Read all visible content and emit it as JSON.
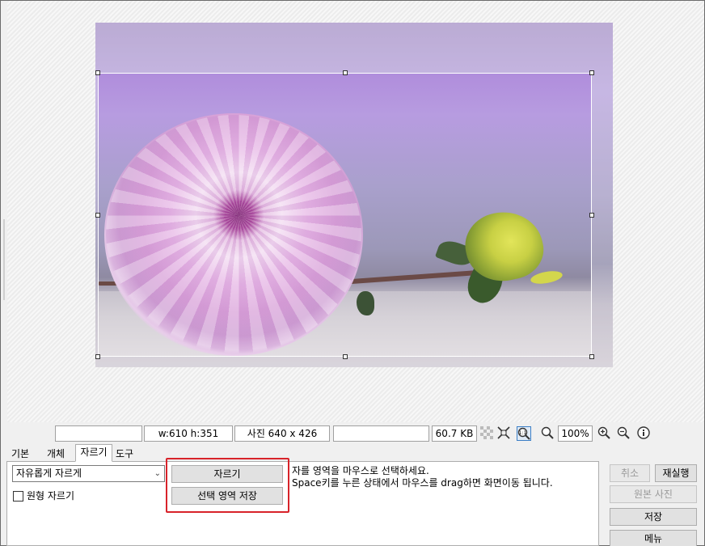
{
  "status": {
    "box1": "",
    "dimensions": "w:610 h:351",
    "photo_size": "사진 640 x 426",
    "box4": "",
    "file_size": "60.7 KB",
    "zoom": "100%",
    "icons": [
      "transparency-icon",
      "fit-window-icon",
      "actual-size-icon",
      "zoom-icon",
      "zoom-in-icon",
      "zoom-out-icon",
      "info-icon"
    ]
  },
  "tabs": [
    "기본",
    "개체",
    "자르기",
    "도구"
  ],
  "active_tab": "자르기",
  "crop": {
    "mode_select": "자유롭게 자르게",
    "circle_crop_label": "원형 자르기",
    "crop_button": "자르기",
    "save_selection_button": "선택 영역 저장",
    "info_line1": "자를 영역을 마우스로 선택하세요.",
    "info_line2": "Space키를 누른 상태에서 마우스를 drag하면 화면이동 됩니다."
  },
  "actions": {
    "cancel": "취소",
    "redo": "재실행",
    "original": "원본 사진",
    "save": "저장",
    "menu": "메뉴"
  },
  "colors": {
    "highlight": "#d8232a",
    "active_zoom": "#3c7fc6"
  }
}
